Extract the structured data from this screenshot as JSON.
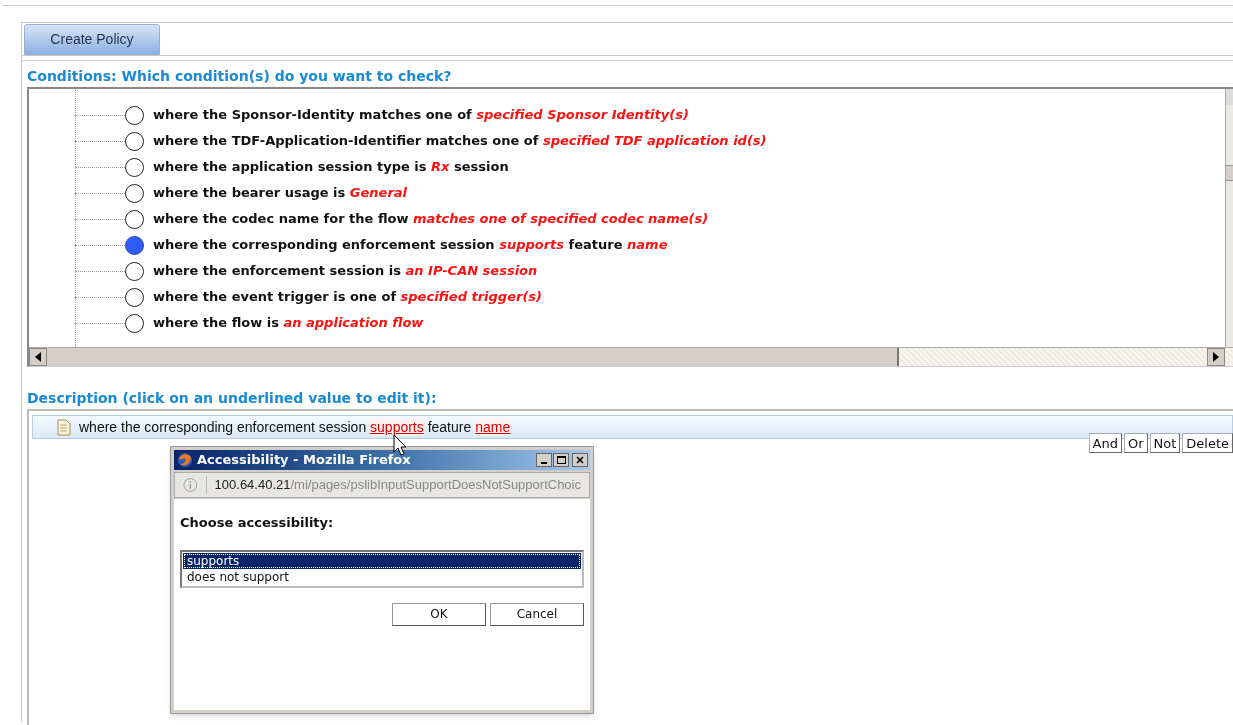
{
  "tab": {
    "label": "Create Policy",
    "selected": true
  },
  "conditions": {
    "heading": "Conditions: Which condition(s) do you want to check?",
    "items": [
      {
        "selected": false,
        "parts": [
          {
            "kind": "plain",
            "text": "where the Sponsor-Identity matches one of "
          },
          {
            "kind": "value",
            "text": "specified Sponsor Identity(s)"
          }
        ]
      },
      {
        "selected": false,
        "parts": [
          {
            "kind": "plain",
            "text": "where the TDF-Application-Identifier matches one of "
          },
          {
            "kind": "value",
            "text": "specified TDF application id(s)"
          }
        ]
      },
      {
        "selected": false,
        "parts": [
          {
            "kind": "plain",
            "text": "where the application session type is "
          },
          {
            "kind": "value",
            "text": "Rx"
          },
          {
            "kind": "plain",
            "text": " session"
          }
        ]
      },
      {
        "selected": false,
        "parts": [
          {
            "kind": "plain",
            "text": "where the bearer usage is "
          },
          {
            "kind": "value",
            "text": "General"
          }
        ]
      },
      {
        "selected": false,
        "parts": [
          {
            "kind": "plain",
            "text": "where the codec name for the flow "
          },
          {
            "kind": "value",
            "text": "matches one of specified codec name(s)"
          }
        ]
      },
      {
        "selected": true,
        "parts": [
          {
            "kind": "plain",
            "text": "where the corresponding enforcement session "
          },
          {
            "kind": "value",
            "text": "supports"
          },
          {
            "kind": "plain",
            "text": " feature "
          },
          {
            "kind": "value",
            "text": "name"
          }
        ]
      },
      {
        "selected": false,
        "parts": [
          {
            "kind": "plain",
            "text": "where the enforcement session is "
          },
          {
            "kind": "value",
            "text": "an IP-CAN session"
          }
        ]
      },
      {
        "selected": false,
        "parts": [
          {
            "kind": "plain",
            "text": "where the event trigger is one of "
          },
          {
            "kind": "value",
            "text": "specified trigger(s)"
          }
        ]
      },
      {
        "selected": false,
        "parts": [
          {
            "kind": "plain",
            "text": "where the flow is "
          },
          {
            "kind": "value",
            "text": "an application flow"
          }
        ]
      }
    ]
  },
  "description": {
    "heading": "Description (click on an underlined value to edit it):",
    "parts": [
      {
        "kind": "plain",
        "text": "where the corresponding enforcement session "
      },
      {
        "kind": "link",
        "text": "supports"
      },
      {
        "kind": "plain",
        "text": " feature "
      },
      {
        "kind": "link",
        "text": "name"
      }
    ],
    "buttons": [
      "And",
      "Or",
      "Not",
      "Delete"
    ]
  },
  "dialog": {
    "title": "Accessibility - Mozilla Firefox",
    "url_host": "100.64.40.21",
    "url_path": "/mi/pages/pslibInputSupportDoesNotSupportChoic",
    "prompt": "Choose accessibility:",
    "options": [
      {
        "label": "supports",
        "selected": true
      },
      {
        "label": "does not support",
        "selected": false
      }
    ],
    "buttons": [
      "OK",
      "Cancel"
    ]
  }
}
